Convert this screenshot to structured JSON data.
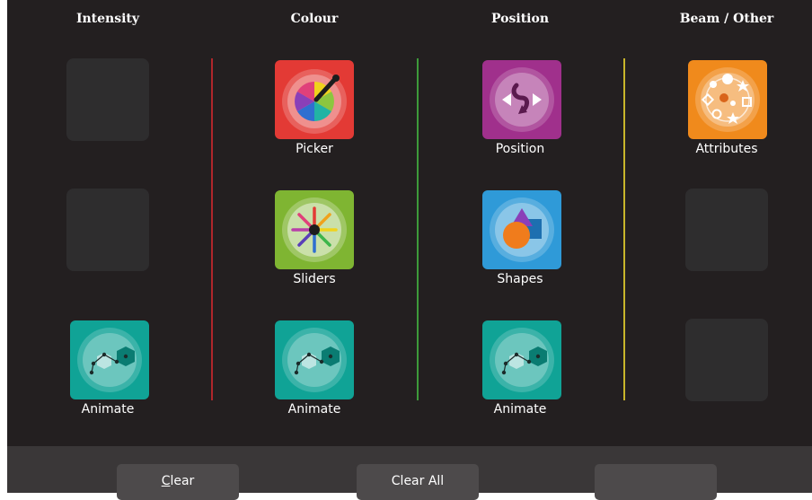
{
  "columns": [
    {
      "title": "Intensity"
    },
    {
      "title": "Colour"
    },
    {
      "title": "Position"
    },
    {
      "title": "Beam / Other"
    }
  ],
  "tiles": {
    "picker": {
      "label": "Picker",
      "icon": "colour-picker-icon"
    },
    "sliders": {
      "label": "Sliders",
      "icon": "colour-sliders-icon"
    },
    "position": {
      "label": "Position",
      "icon": "position-icon"
    },
    "shapes": {
      "label": "Shapes",
      "icon": "shapes-icon"
    },
    "attributes": {
      "label": "Attributes",
      "icon": "attributes-icon"
    },
    "animate_intensity": {
      "label": "Animate",
      "icon": "animate-icon"
    },
    "animate_colour": {
      "label": "Animate",
      "icon": "animate-icon"
    },
    "animate_position": {
      "label": "Animate",
      "icon": "animate-icon"
    }
  },
  "buttons": {
    "clear_mnemonic": "C",
    "clear_rest": "lear",
    "clear_all": "Clear All",
    "third": ""
  },
  "colors": {
    "background": "#231f20",
    "divider_colour": "#b0262b",
    "divider_position": "#3d9a3a",
    "divider_beam": "#c9b52a",
    "picker": "#e33a35",
    "sliders": "#7fb532",
    "position": "#a0308c",
    "shapes": "#2f9ad8",
    "attributes": "#f08a1c",
    "animate": "#10a396"
  }
}
